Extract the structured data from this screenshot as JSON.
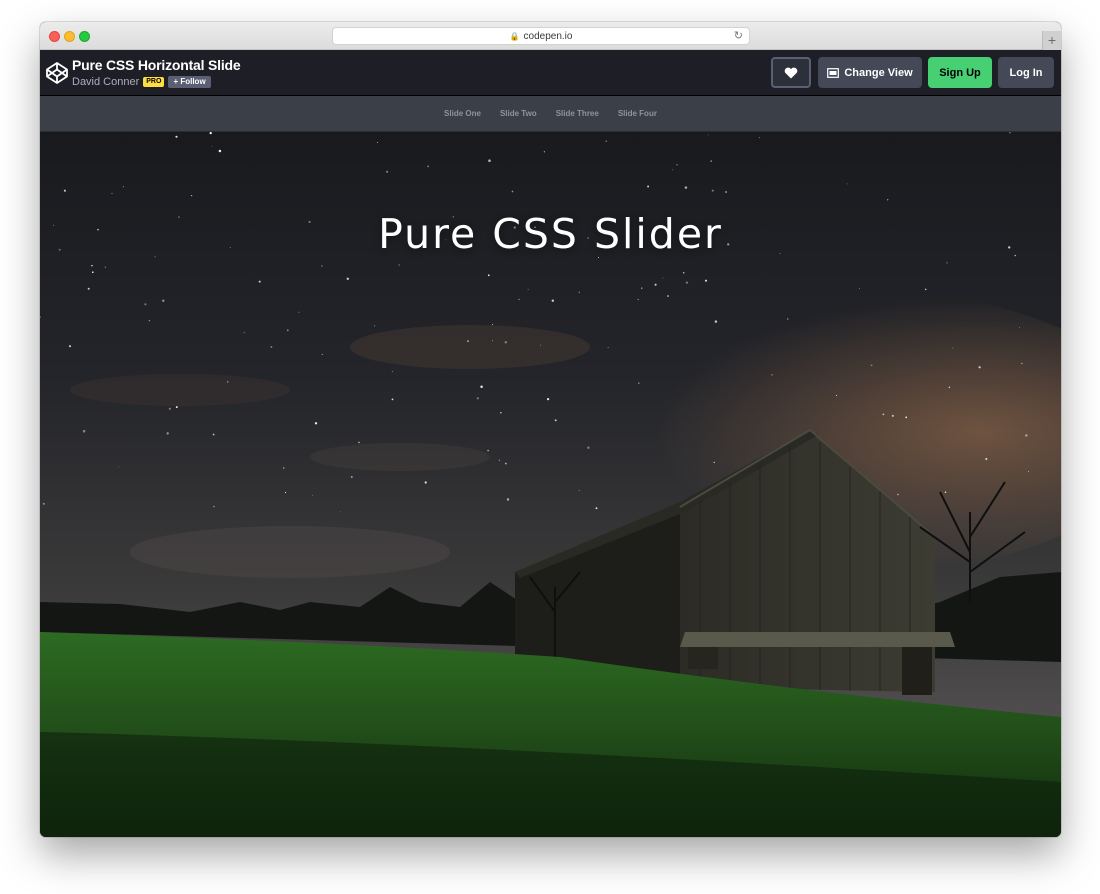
{
  "browser": {
    "url": "codepen.io",
    "lock_icon": "lock-icon",
    "reload_icon": "reload-icon",
    "new_tab_label": "+"
  },
  "header": {
    "pen_title": "Pure CSS Horizontal Slide",
    "author": "David Conner",
    "pro_badge": "PRO",
    "follow_label": "+ Follow",
    "heart_icon": "heart-icon",
    "change_view_label": "Change View",
    "signup_label": "Sign Up",
    "login_label": "Log In",
    "colors": {
      "bar": "#1e1f26",
      "signup": "#47cf73",
      "pro": "#ffdd40"
    }
  },
  "nav": {
    "items": [
      {
        "label": "Slide One"
      },
      {
        "label": "Slide Two"
      },
      {
        "label": "Slide Three"
      },
      {
        "label": "Slide Four"
      }
    ]
  },
  "hero": {
    "title": "Pure CSS Slider",
    "image": "night-sky-barn"
  }
}
